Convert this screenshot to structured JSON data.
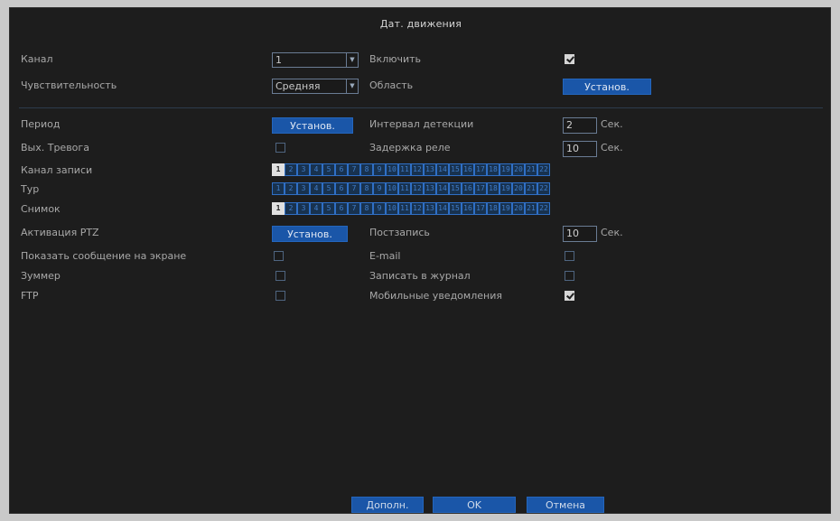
{
  "dialog": {
    "title": "Дат. движения"
  },
  "top": {
    "channel_label": "Канал",
    "channel_value": "1",
    "enable_label": "Включить",
    "enable_checked": true,
    "sensitivity_label": "Чувствительность",
    "sensitivity_value": "Средняя",
    "area_label": "Область",
    "area_button": "Установ."
  },
  "settings": {
    "period_label": "Период",
    "period_button": "Установ.",
    "detect_interval_label": "Интервал детекции",
    "detect_interval_value": "2",
    "detect_interval_unit": "Сек.",
    "alarm_out_label": "Вых. Тревога",
    "alarm_out_checked": false,
    "relay_delay_label": "Задержка реле",
    "relay_delay_value": "10",
    "relay_delay_unit": "Сек.",
    "record_channel_label": "Канал записи",
    "tour_label": "Тур",
    "snapshot_label": "Снимок",
    "ptz_label": "Активация PTZ",
    "ptz_button": "Установ.",
    "post_record_label": "Постзапись",
    "post_record_value": "10",
    "post_record_unit": "Сек.",
    "show_message_label": "Показать сообщение на экране",
    "show_message_checked": false,
    "email_label": "E-mail",
    "email_checked": false,
    "buzzer_label": "Зуммер",
    "buzzer_checked": false,
    "write_log_label": "Записать в журнал",
    "write_log_checked": false,
    "ftp_label": "FTP",
    "ftp_checked": false,
    "mobile_label": "Мобильные уведомления",
    "mobile_checked": true
  },
  "channel_grids": {
    "record": {
      "cells": [
        "1",
        "2",
        "3",
        "4",
        "5",
        "6",
        "7",
        "8",
        "9",
        "10",
        "11",
        "12",
        "13",
        "14",
        "15",
        "16",
        "17",
        "18",
        "19",
        "20",
        "21",
        "22"
      ],
      "selected": [
        0
      ]
    },
    "tour": {
      "cells": [
        "1",
        "2",
        "3",
        "4",
        "5",
        "6",
        "7",
        "8",
        "9",
        "10",
        "11",
        "12",
        "13",
        "14",
        "15",
        "16",
        "17",
        "18",
        "19",
        "20",
        "21",
        "22"
      ],
      "selected": []
    },
    "snapshot": {
      "cells": [
        "1",
        "2",
        "3",
        "4",
        "5",
        "6",
        "7",
        "8",
        "9",
        "10",
        "11",
        "12",
        "13",
        "14",
        "15",
        "16",
        "17",
        "18",
        "19",
        "20",
        "21",
        "22"
      ],
      "selected": [
        0
      ]
    }
  },
  "footer": {
    "advanced_button": "Дополн.",
    "ok_button": "OK",
    "cancel_button": "Отмена"
  },
  "colors": {
    "background": "#1d1d1d",
    "accent": "#1a56a8",
    "text": "#a8a8a8"
  }
}
